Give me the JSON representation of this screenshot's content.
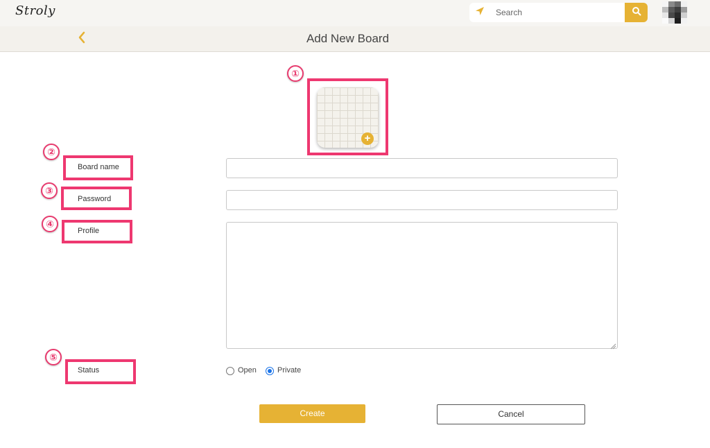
{
  "app": {
    "logo_text": "Stroly"
  },
  "search": {
    "placeholder": "Search"
  },
  "header": {
    "title": "Add New Board"
  },
  "markers": [
    "①",
    "②",
    "③",
    "④",
    "⑤"
  ],
  "form": {
    "board_name_label": "Board name",
    "password_label": "Password",
    "profile_label": "Profile",
    "status_label": "Status",
    "board_name_value": "",
    "password_value": "",
    "profile_value": "",
    "status_options": [
      "Open",
      "Private"
    ],
    "status_selected": "Private"
  },
  "actions": {
    "create_label": "Create",
    "cancel_label": "Cancel"
  },
  "colors": {
    "accent": "#e6b234",
    "highlight": "#ee3870",
    "radio_selected": "#1a73e8"
  },
  "icons": {
    "nav": "location-arrow-icon",
    "search": "search-icon",
    "back": "chevron-left-icon",
    "add": "plus-circle-icon",
    "resize": "resize-grip-icon"
  }
}
